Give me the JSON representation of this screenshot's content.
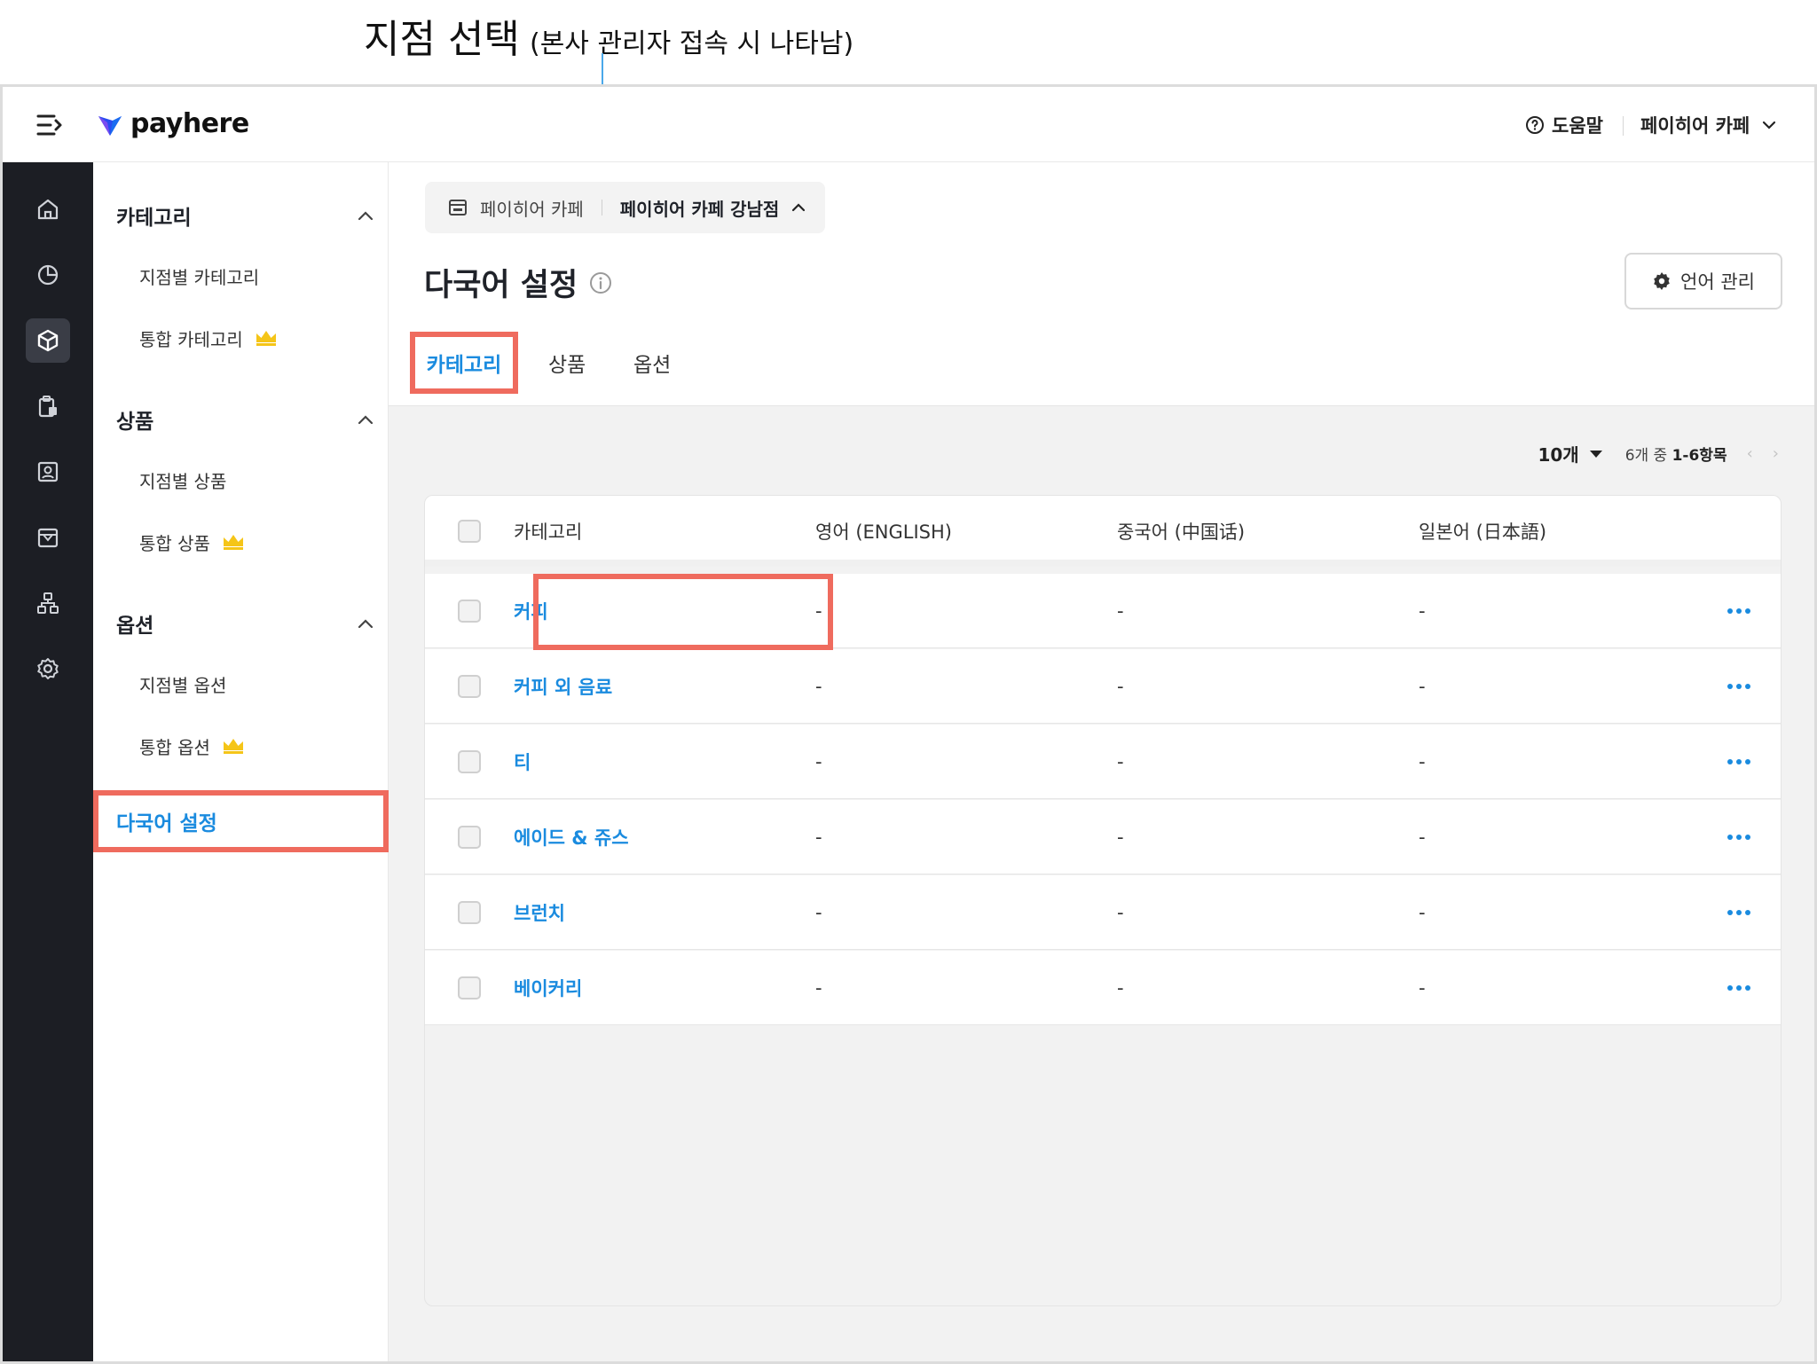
{
  "annotation": {
    "title": "지점 선택",
    "subtitle": "(본사 관리자 접속 시 나타남)"
  },
  "header": {
    "brand": "payhere",
    "help_label": "도움말",
    "store_name": "페이히어 카페"
  },
  "rail": {
    "items": [
      "home-icon",
      "chart-icon",
      "box-icon",
      "clipboard-icon",
      "contact-icon",
      "store-icon",
      "org-icon",
      "gear-icon"
    ],
    "active_index": 2
  },
  "sidebar": {
    "sections": [
      {
        "title": "카테고리",
        "items": [
          {
            "label": "지점별 카테고리",
            "premium": false
          },
          {
            "label": "통합 카테고리",
            "premium": true
          }
        ]
      },
      {
        "title": "상품",
        "items": [
          {
            "label": "지점별 상품",
            "premium": false
          },
          {
            "label": "통합 상품",
            "premium": true
          }
        ]
      },
      {
        "title": "옵션",
        "items": [
          {
            "label": "지점별 옵션",
            "premium": false
          },
          {
            "label": "통합 옵션",
            "premium": true
          }
        ]
      }
    ],
    "active_item": "다국어 설정"
  },
  "main": {
    "store_selector": {
      "brand": "페이히어 카페",
      "branch": "페이히어 카페 강남점"
    },
    "page_title": "다국어 설정",
    "language_button": "언어 관리",
    "tabs": [
      {
        "label": "카테고리",
        "active": true
      },
      {
        "label": "상품",
        "active": false
      },
      {
        "label": "옵션",
        "active": false
      }
    ],
    "pager": {
      "page_size": "10개",
      "range_prefix": "6개 중",
      "range": "1-6항목"
    },
    "table": {
      "columns": [
        "카테고리",
        "영어 (ENGLISH)",
        "중국어 (中国话)",
        "일본어 (日本語)"
      ],
      "rows": [
        {
          "category": "커피",
          "english": "-",
          "chinese": "-",
          "japanese": "-"
        },
        {
          "category": "커피 외 음료",
          "english": "-",
          "chinese": "-",
          "japanese": "-"
        },
        {
          "category": "티",
          "english": "-",
          "chinese": "-",
          "japanese": "-"
        },
        {
          "category": "에이드 & 쥬스",
          "english": "-",
          "chinese": "-",
          "japanese": "-"
        },
        {
          "category": "브런치",
          "english": "-",
          "chinese": "-",
          "japanese": "-"
        },
        {
          "category": "베이커리",
          "english": "-",
          "chinese": "-",
          "japanese": "-"
        }
      ]
    }
  },
  "colors": {
    "accent": "#1a8bdf",
    "highlight": "#ef6b5e",
    "rail_bg": "#1c1e24",
    "premium": "#f5c518",
    "annotation": "#4aa8ea"
  }
}
